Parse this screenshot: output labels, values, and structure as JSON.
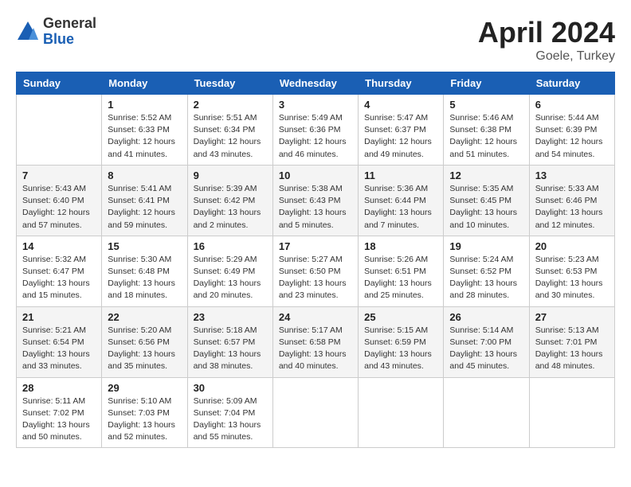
{
  "header": {
    "logo_general": "General",
    "logo_blue": "Blue",
    "title": "April 2024",
    "location": "Goele, Turkey"
  },
  "weekdays": [
    "Sunday",
    "Monday",
    "Tuesday",
    "Wednesday",
    "Thursday",
    "Friday",
    "Saturday"
  ],
  "weeks": [
    [
      {
        "num": "",
        "info": ""
      },
      {
        "num": "1",
        "info": "Sunrise: 5:52 AM\nSunset: 6:33 PM\nDaylight: 12 hours\nand 41 minutes."
      },
      {
        "num": "2",
        "info": "Sunrise: 5:51 AM\nSunset: 6:34 PM\nDaylight: 12 hours\nand 43 minutes."
      },
      {
        "num": "3",
        "info": "Sunrise: 5:49 AM\nSunset: 6:36 PM\nDaylight: 12 hours\nand 46 minutes."
      },
      {
        "num": "4",
        "info": "Sunrise: 5:47 AM\nSunset: 6:37 PM\nDaylight: 12 hours\nand 49 minutes."
      },
      {
        "num": "5",
        "info": "Sunrise: 5:46 AM\nSunset: 6:38 PM\nDaylight: 12 hours\nand 51 minutes."
      },
      {
        "num": "6",
        "info": "Sunrise: 5:44 AM\nSunset: 6:39 PM\nDaylight: 12 hours\nand 54 minutes."
      }
    ],
    [
      {
        "num": "7",
        "info": "Sunrise: 5:43 AM\nSunset: 6:40 PM\nDaylight: 12 hours\nand 57 minutes."
      },
      {
        "num": "8",
        "info": "Sunrise: 5:41 AM\nSunset: 6:41 PM\nDaylight: 12 hours\nand 59 minutes."
      },
      {
        "num": "9",
        "info": "Sunrise: 5:39 AM\nSunset: 6:42 PM\nDaylight: 13 hours\nand 2 minutes."
      },
      {
        "num": "10",
        "info": "Sunrise: 5:38 AM\nSunset: 6:43 PM\nDaylight: 13 hours\nand 5 minutes."
      },
      {
        "num": "11",
        "info": "Sunrise: 5:36 AM\nSunset: 6:44 PM\nDaylight: 13 hours\nand 7 minutes."
      },
      {
        "num": "12",
        "info": "Sunrise: 5:35 AM\nSunset: 6:45 PM\nDaylight: 13 hours\nand 10 minutes."
      },
      {
        "num": "13",
        "info": "Sunrise: 5:33 AM\nSunset: 6:46 PM\nDaylight: 13 hours\nand 12 minutes."
      }
    ],
    [
      {
        "num": "14",
        "info": "Sunrise: 5:32 AM\nSunset: 6:47 PM\nDaylight: 13 hours\nand 15 minutes."
      },
      {
        "num": "15",
        "info": "Sunrise: 5:30 AM\nSunset: 6:48 PM\nDaylight: 13 hours\nand 18 minutes."
      },
      {
        "num": "16",
        "info": "Sunrise: 5:29 AM\nSunset: 6:49 PM\nDaylight: 13 hours\nand 20 minutes."
      },
      {
        "num": "17",
        "info": "Sunrise: 5:27 AM\nSunset: 6:50 PM\nDaylight: 13 hours\nand 23 minutes."
      },
      {
        "num": "18",
        "info": "Sunrise: 5:26 AM\nSunset: 6:51 PM\nDaylight: 13 hours\nand 25 minutes."
      },
      {
        "num": "19",
        "info": "Sunrise: 5:24 AM\nSunset: 6:52 PM\nDaylight: 13 hours\nand 28 minutes."
      },
      {
        "num": "20",
        "info": "Sunrise: 5:23 AM\nSunset: 6:53 PM\nDaylight: 13 hours\nand 30 minutes."
      }
    ],
    [
      {
        "num": "21",
        "info": "Sunrise: 5:21 AM\nSunset: 6:54 PM\nDaylight: 13 hours\nand 33 minutes."
      },
      {
        "num": "22",
        "info": "Sunrise: 5:20 AM\nSunset: 6:56 PM\nDaylight: 13 hours\nand 35 minutes."
      },
      {
        "num": "23",
        "info": "Sunrise: 5:18 AM\nSunset: 6:57 PM\nDaylight: 13 hours\nand 38 minutes."
      },
      {
        "num": "24",
        "info": "Sunrise: 5:17 AM\nSunset: 6:58 PM\nDaylight: 13 hours\nand 40 minutes."
      },
      {
        "num": "25",
        "info": "Sunrise: 5:15 AM\nSunset: 6:59 PM\nDaylight: 13 hours\nand 43 minutes."
      },
      {
        "num": "26",
        "info": "Sunrise: 5:14 AM\nSunset: 7:00 PM\nDaylight: 13 hours\nand 45 minutes."
      },
      {
        "num": "27",
        "info": "Sunrise: 5:13 AM\nSunset: 7:01 PM\nDaylight: 13 hours\nand 48 minutes."
      }
    ],
    [
      {
        "num": "28",
        "info": "Sunrise: 5:11 AM\nSunset: 7:02 PM\nDaylight: 13 hours\nand 50 minutes."
      },
      {
        "num": "29",
        "info": "Sunrise: 5:10 AM\nSunset: 7:03 PM\nDaylight: 13 hours\nand 52 minutes."
      },
      {
        "num": "30",
        "info": "Sunrise: 5:09 AM\nSunset: 7:04 PM\nDaylight: 13 hours\nand 55 minutes."
      },
      {
        "num": "",
        "info": ""
      },
      {
        "num": "",
        "info": ""
      },
      {
        "num": "",
        "info": ""
      },
      {
        "num": "",
        "info": ""
      }
    ]
  ]
}
